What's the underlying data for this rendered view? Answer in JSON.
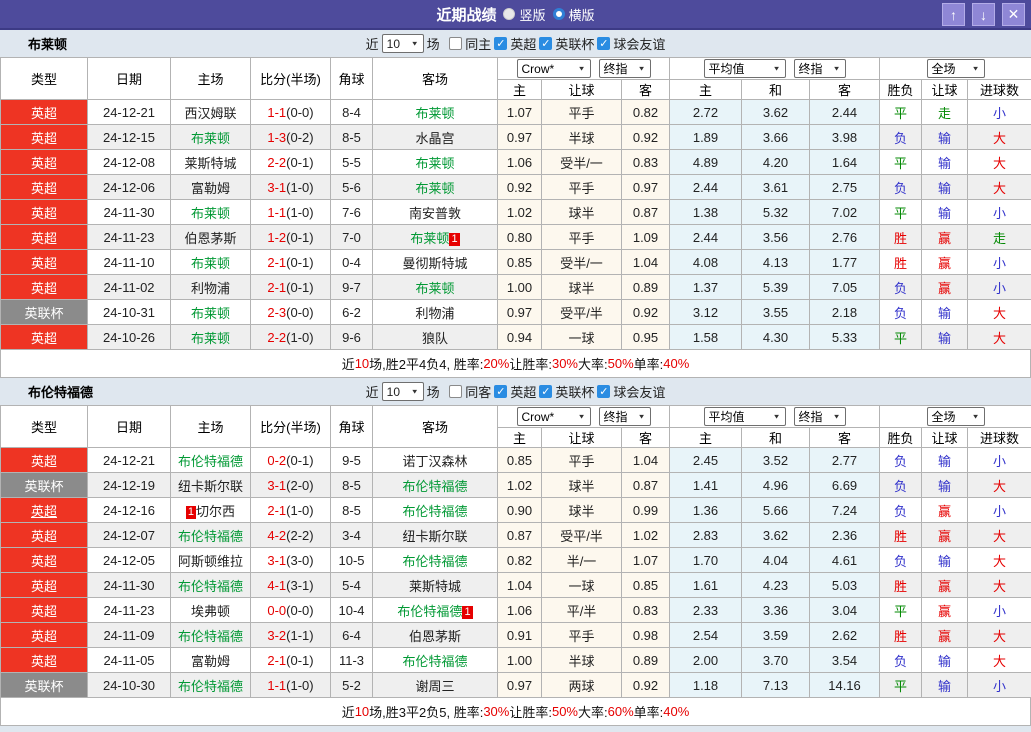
{
  "topbar": {
    "title": "近期战绩",
    "vertical_label": "竖版",
    "horizontal_label": "横版"
  },
  "icons": {
    "up": "↑",
    "down": "↓",
    "close": "✕",
    "check": "✓",
    "dropdown": "▼"
  },
  "colors": {
    "accent_purple": "#4e4b9c",
    "league_red": "#ee3423",
    "league_gray": "#8b8b8b",
    "team_green": "#019934",
    "win_red": "#e60000",
    "draw_green": "#018801",
    "lose_blue": "#3333cc"
  },
  "header": {
    "columns": [
      "类型",
      "日期",
      "主场",
      "比分(半场)",
      "角球",
      "客场"
    ],
    "sub_columns": [
      "主",
      "让球",
      "客",
      "主",
      "和",
      "客",
      "胜负",
      "让球",
      "进球数"
    ],
    "selects": {
      "crow": "Crow*",
      "final1": "终指",
      "avg": "平均值",
      "final2": "终指",
      "full": "全场"
    }
  },
  "sections": [
    {
      "team": "布莱顿",
      "filter": {
        "near": "近",
        "count": "10",
        "unit": "场",
        "same_label": "同主",
        "same_checked": false,
        "leagues": [
          {
            "label": "英超",
            "checked": true
          },
          {
            "label": "英联杯",
            "checked": true
          },
          {
            "label": "球会友谊",
            "checked": true
          }
        ]
      },
      "rows": [
        {
          "type": "英超",
          "date": "24-12-21",
          "home": "西汉姆联",
          "home_focus": false,
          "score": "1-1",
          "half": "(0-0)",
          "corner": "8-4",
          "away": "布莱顿",
          "away_focus": true,
          "odds": [
            "1.07",
            "平手",
            "0.82"
          ],
          "avg": [
            "2.72",
            "3.62",
            "2.44"
          ],
          "results": [
            "平",
            "走",
            "小"
          ]
        },
        {
          "type": "英超",
          "date": "24-12-15",
          "home": "布莱顿",
          "home_focus": true,
          "score": "1-3",
          "half": "(0-2)",
          "corner": "8-5",
          "away": "水晶宫",
          "away_focus": false,
          "odds": [
            "0.97",
            "半球",
            "0.92"
          ],
          "avg": [
            "1.89",
            "3.66",
            "3.98"
          ],
          "results": [
            "负",
            "输",
            "大"
          ]
        },
        {
          "type": "英超",
          "date": "24-12-08",
          "home": "莱斯特城",
          "home_focus": false,
          "score": "2-2",
          "half": "(0-1)",
          "corner": "5-5",
          "away": "布莱顿",
          "away_focus": true,
          "odds": [
            "1.06",
            "受半/一",
            "0.83"
          ],
          "avg": [
            "4.89",
            "4.20",
            "1.64"
          ],
          "results": [
            "平",
            "输",
            "大"
          ]
        },
        {
          "type": "英超",
          "date": "24-12-06",
          "home": "富勒姆",
          "home_focus": false,
          "score": "3-1",
          "half": "(1-0)",
          "corner": "5-6",
          "away": "布莱顿",
          "away_focus": true,
          "odds": [
            "0.92",
            "平手",
            "0.97"
          ],
          "avg": [
            "2.44",
            "3.61",
            "2.75"
          ],
          "results": [
            "负",
            "输",
            "大"
          ]
        },
        {
          "type": "英超",
          "date": "24-11-30",
          "home": "布莱顿",
          "home_focus": true,
          "score": "1-1",
          "half": "(1-0)",
          "corner": "7-6",
          "away": "南安普敦",
          "away_focus": false,
          "odds": [
            "1.02",
            "球半",
            "0.87"
          ],
          "avg": [
            "1.38",
            "5.32",
            "7.02"
          ],
          "results": [
            "平",
            "输",
            "小"
          ]
        },
        {
          "type": "英超",
          "date": "24-11-23",
          "home": "伯恩茅斯",
          "home_focus": false,
          "score": "1-2",
          "half": "(0-1)",
          "corner": "7-0",
          "away": "布莱顿",
          "away_focus": true,
          "away_badge": "1",
          "away_badge_pos": "after",
          "odds": [
            "0.80",
            "平手",
            "1.09"
          ],
          "avg": [
            "2.44",
            "3.56",
            "2.76"
          ],
          "results": [
            "胜",
            "赢",
            "走"
          ]
        },
        {
          "type": "英超",
          "date": "24-11-10",
          "home": "布莱顿",
          "home_focus": true,
          "score": "2-1",
          "half": "(0-1)",
          "corner": "0-4",
          "away": "曼彻斯特城",
          "away_focus": false,
          "odds": [
            "0.85",
            "受半/一",
            "1.04"
          ],
          "avg": [
            "4.08",
            "4.13",
            "1.77"
          ],
          "results": [
            "胜",
            "赢",
            "小"
          ]
        },
        {
          "type": "英超",
          "date": "24-11-02",
          "home": "利物浦",
          "home_focus": false,
          "score": "2-1",
          "half": "(0-1)",
          "corner": "9-7",
          "away": "布莱顿",
          "away_focus": true,
          "odds": [
            "1.00",
            "球半",
            "0.89"
          ],
          "avg": [
            "1.37",
            "5.39",
            "7.05"
          ],
          "results": [
            "负",
            "赢",
            "小"
          ]
        },
        {
          "type": "英联杯",
          "date": "24-10-31",
          "home": "布莱顿",
          "home_focus": true,
          "score": "2-3",
          "half": "(0-0)",
          "corner": "6-2",
          "away": "利物浦",
          "away_focus": false,
          "odds": [
            "0.97",
            "受平/半",
            "0.92"
          ],
          "avg": [
            "3.12",
            "3.55",
            "2.18"
          ],
          "results": [
            "负",
            "输",
            "大"
          ]
        },
        {
          "type": "英超",
          "date": "24-10-26",
          "home": "布莱顿",
          "home_focus": true,
          "score": "2-2",
          "half": "(1-0)",
          "corner": "9-6",
          "away": "狼队",
          "away_focus": false,
          "odds": [
            "0.94",
            "一球",
            "0.95"
          ],
          "avg": [
            "1.58",
            "4.30",
            "5.33"
          ],
          "results": [
            "平",
            "输",
            "大"
          ]
        }
      ],
      "summary": [
        [
          "近",
          "n"
        ],
        [
          "10",
          "r"
        ],
        [
          "场,胜2平4负4, 胜率:",
          "n"
        ],
        [
          "20%",
          "r"
        ],
        [
          " 让胜率:",
          "n"
        ],
        [
          "30%",
          "r"
        ],
        [
          " 大率:",
          "n"
        ],
        [
          "50%",
          "r"
        ],
        [
          " 单率:",
          "n"
        ],
        [
          "40%",
          "r"
        ]
      ]
    },
    {
      "team": "布伦特福德",
      "filter": {
        "near": "近",
        "count": "10",
        "unit": "场",
        "same_label": "同客",
        "same_checked": false,
        "leagues": [
          {
            "label": "英超",
            "checked": true
          },
          {
            "label": "英联杯",
            "checked": true
          },
          {
            "label": "球会友谊",
            "checked": true
          }
        ]
      },
      "rows": [
        {
          "type": "英超",
          "date": "24-12-21",
          "home": "布伦特福德",
          "home_focus": true,
          "score": "0-2",
          "half": "(0-1)",
          "corner": "9-5",
          "away": "诺丁汉森林",
          "away_focus": false,
          "odds": [
            "0.85",
            "平手",
            "1.04"
          ],
          "avg": [
            "2.45",
            "3.52",
            "2.77"
          ],
          "results": [
            "负",
            "输",
            "小"
          ]
        },
        {
          "type": "英联杯",
          "date": "24-12-19",
          "home": "纽卡斯尔联",
          "home_focus": false,
          "score": "3-1",
          "half": "(2-0)",
          "corner": "8-5",
          "away": "布伦特福德",
          "away_focus": true,
          "odds": [
            "1.02",
            "球半",
            "0.87"
          ],
          "avg": [
            "1.41",
            "4.96",
            "6.69"
          ],
          "results": [
            "负",
            "输",
            "大"
          ]
        },
        {
          "type": "英超",
          "type_underline": true,
          "date": "24-12-16",
          "home": "切尔西",
          "home_focus": false,
          "home_badge": "1",
          "home_badge_pos": "before",
          "score": "2-1",
          "half": "(1-0)",
          "corner": "8-5",
          "away": "布伦特福德",
          "away_focus": true,
          "odds": [
            "0.90",
            "球半",
            "0.99"
          ],
          "avg": [
            "1.36",
            "5.66",
            "7.24"
          ],
          "results": [
            "负",
            "赢",
            "小"
          ]
        },
        {
          "type": "英超",
          "date": "24-12-07",
          "home": "布伦特福德",
          "home_focus": true,
          "score": "4-2",
          "half": "(2-2)",
          "corner": "3-4",
          "away": "纽卡斯尔联",
          "away_focus": false,
          "odds": [
            "0.87",
            "受平/半",
            "1.02"
          ],
          "avg": [
            "2.83",
            "3.62",
            "2.36"
          ],
          "results": [
            "胜",
            "赢",
            "大"
          ]
        },
        {
          "type": "英超",
          "date": "24-12-05",
          "home": "阿斯顿维拉",
          "home_focus": false,
          "score": "3-1",
          "half": "(3-0)",
          "corner": "10-5",
          "away": "布伦特福德",
          "away_focus": true,
          "odds": [
            "0.82",
            "半/一",
            "1.07"
          ],
          "avg": [
            "1.70",
            "4.04",
            "4.61"
          ],
          "results": [
            "负",
            "输",
            "大"
          ]
        },
        {
          "type": "英超",
          "date": "24-11-30",
          "home": "布伦特福德",
          "home_focus": true,
          "score": "4-1",
          "half": "(3-1)",
          "corner": "5-4",
          "away": "莱斯特城",
          "away_focus": false,
          "odds": [
            "1.04",
            "一球",
            "0.85"
          ],
          "avg": [
            "1.61",
            "4.23",
            "5.03"
          ],
          "results": [
            "胜",
            "赢",
            "大"
          ]
        },
        {
          "type": "英超",
          "date": "24-11-23",
          "home": "埃弗顿",
          "home_focus": false,
          "score": "0-0",
          "half": "(0-0)",
          "corner": "10-4",
          "away": "布伦特福德",
          "away_focus": true,
          "away_badge": "1",
          "away_badge_pos": "after",
          "odds": [
            "1.06",
            "平/半",
            "0.83"
          ],
          "avg": [
            "2.33",
            "3.36",
            "3.04"
          ],
          "results": [
            "平",
            "赢",
            "小"
          ]
        },
        {
          "type": "英超",
          "date": "24-11-09",
          "home": "布伦特福德",
          "home_focus": true,
          "score": "3-2",
          "half": "(1-1)",
          "corner": "6-4",
          "away": "伯恩茅斯",
          "away_focus": false,
          "odds": [
            "0.91",
            "平手",
            "0.98"
          ],
          "avg": [
            "2.54",
            "3.59",
            "2.62"
          ],
          "results": [
            "胜",
            "赢",
            "大"
          ]
        },
        {
          "type": "英超",
          "date": "24-11-05",
          "home": "富勒姆",
          "home_focus": false,
          "score": "2-1",
          "half": "(0-1)",
          "corner": "11-3",
          "away": "布伦特福德",
          "away_focus": true,
          "odds": [
            "1.00",
            "半球",
            "0.89"
          ],
          "avg": [
            "2.00",
            "3.70",
            "3.54"
          ],
          "results": [
            "负",
            "输",
            "大"
          ]
        },
        {
          "type": "英联杯",
          "date": "24-10-30",
          "home": "布伦特福德",
          "home_focus": true,
          "score": "1-1",
          "half": "(1-0)",
          "corner": "5-2",
          "away": "谢周三",
          "away_focus": false,
          "odds": [
            "0.97",
            "两球",
            "0.92"
          ],
          "avg": [
            "1.18",
            "7.13",
            "14.16"
          ],
          "results": [
            "平",
            "输",
            "小"
          ]
        }
      ],
      "summary": [
        [
          "近",
          "n"
        ],
        [
          "10",
          "r"
        ],
        [
          "场,胜3平2负5, 胜率:",
          "n"
        ],
        [
          "30%",
          "r"
        ],
        [
          " 让胜率:",
          "n"
        ],
        [
          "50%",
          "r"
        ],
        [
          " 大率:",
          "n"
        ],
        [
          "60%",
          "r"
        ],
        [
          " 单率:",
          "n"
        ],
        [
          "40%",
          "r"
        ]
      ]
    }
  ]
}
